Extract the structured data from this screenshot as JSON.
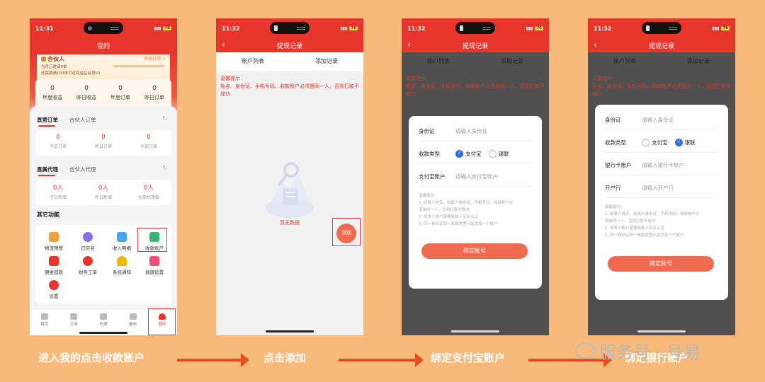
{
  "phone1": {
    "time": "11:31",
    "title": "我的",
    "partner": {
      "title": "合伙人",
      "link": "等级详情 >",
      "line1": "当月已邀请0单",
      "line2": "还需邀请100单可达到金钻会员V1"
    },
    "stats": [
      {
        "value": "0",
        "label": "年度收益"
      },
      {
        "value": "0",
        "label": "昨日收益"
      },
      {
        "value": "0",
        "label": "年度订单"
      },
      {
        "value": "0",
        "label": "昨日订单"
      }
    ],
    "orders": {
      "tab_active": "直营订单",
      "tab_inactive": "合伙人订单",
      "items": [
        {
          "value": "0",
          "label": "今日订单"
        },
        {
          "value": "0",
          "label": "昨日订单"
        },
        {
          "value": "0",
          "label": "全部订单"
        }
      ]
    },
    "agents": {
      "tab_active": "直属代理",
      "tab_inactive": "合伙人代理",
      "items": [
        {
          "value": "0人",
          "label": "今日新增"
        },
        {
          "value": "0人",
          "label": "昨日新增"
        },
        {
          "value": "0人",
          "label": "全部代理数"
        }
      ]
    },
    "others_title": "其它功能",
    "functions": [
      {
        "label": "物流预警",
        "icon": "truck-icon",
        "color": "#f2a23a"
      },
      {
        "label": "已实名",
        "icon": "verified-user-icon",
        "color": "#8a6de9"
      },
      {
        "label": "收入明细",
        "icon": "income-icon",
        "color": "#4aa3f0"
      },
      {
        "label": "收款账户",
        "icon": "wallet-icon",
        "color": "#3cb371"
      },
      {
        "label": "佣金提现",
        "icon": "withdraw-icon",
        "color": "#e8352c"
      },
      {
        "label": "财务工单",
        "icon": "bag-icon",
        "color": "#e8352c"
      },
      {
        "label": "系统通知",
        "icon": "bell-icon",
        "color": "#f2b800"
      },
      {
        "label": "插旗设置",
        "icon": "flag-icon",
        "color": "#ee4d7a"
      },
      {
        "label": "设置",
        "icon": "gear-icon",
        "color": "#e8352c"
      }
    ],
    "nav": [
      {
        "label": "首页",
        "icon": "home-icon"
      },
      {
        "label": "订单",
        "icon": "order-icon"
      },
      {
        "label": "代理",
        "icon": "agent-icon"
      },
      {
        "label": "素材",
        "icon": "material-icon"
      },
      {
        "label": "我的",
        "icon": "user-icon"
      }
    ]
  },
  "phone2": {
    "time": "11:32",
    "title": "提现记录",
    "tab1": "账户列表",
    "tab2": "添加记录",
    "notice_title": "温馨提示",
    "notice_body": "姓名、身份证、手机号码、收款账户必须是同一人，否则打款不成功",
    "empty_text": "暂无数据",
    "add_label": "添加"
  },
  "phone3": {
    "time": "11:32",
    "title": "提现记录",
    "tab1": "账户列表",
    "tab2": "添加记录",
    "notice_title": "温馨提示",
    "notice_body": "姓名、身份证、手机号码、收款账户必须是同一人，否则打款不成功",
    "id_label": "身份证",
    "id_placeholder": "请输入身份证",
    "type_label": "收款类型",
    "opt_alipay": "支付宝",
    "opt_bank": "银联",
    "account_label": "支付宝账户",
    "account_placeholder": "请输入支付宝账户",
    "notes_title": "温馨提示：",
    "note1": "1. 收款人姓名、收款人身份证、手机号码、收款账户必",
    "note1b": "须是同一人，否则打款不成功",
    "note2": "2. 非本人账户需要收款人实名认证",
    "note3": "3. 同一身份证同一收款类型只能添加一个账户",
    "bind_label": "绑定账号"
  },
  "phone4": {
    "time": "11:32",
    "title": "提现记录",
    "tab1": "账户列表",
    "tab2": "添加记录",
    "notice_title": "温馨提示",
    "notice_body": "姓名、身份证、手机号码、收款账户必须是同一人，否则打款不成功",
    "id_label": "身份证",
    "id_placeholder": "请输入身份证",
    "type_label": "收款类型",
    "opt_alipay": "支付宝",
    "opt_bank": "银联",
    "card_label": "银行卡账户",
    "card_placeholder": "请输入银行卡账户",
    "bank_label": "开户行",
    "bank_placeholder": "请输入开户行",
    "notes_title": "温馨提示：",
    "note1": "1. 收款人姓名、收款人身份证、手机号码、收款账户必",
    "note1b": "须是同一人，否则打款不成功",
    "note2": "2. 非本人账户需要收款人实名认证",
    "note3": "3. 同一身份证同一收款类型只能添加一个账户",
    "bind_label": "绑定账号"
  },
  "captions": {
    "step1": "进入我的点击收款账户",
    "step2": "点击添加",
    "step3": "绑定支付宝账户",
    "step4": "绑定银行账户"
  },
  "watermark": "服务号 · 号易",
  "colors": {
    "accent": "#e8352c",
    "button": "#f06a4f",
    "background": "#f8ba7a"
  }
}
